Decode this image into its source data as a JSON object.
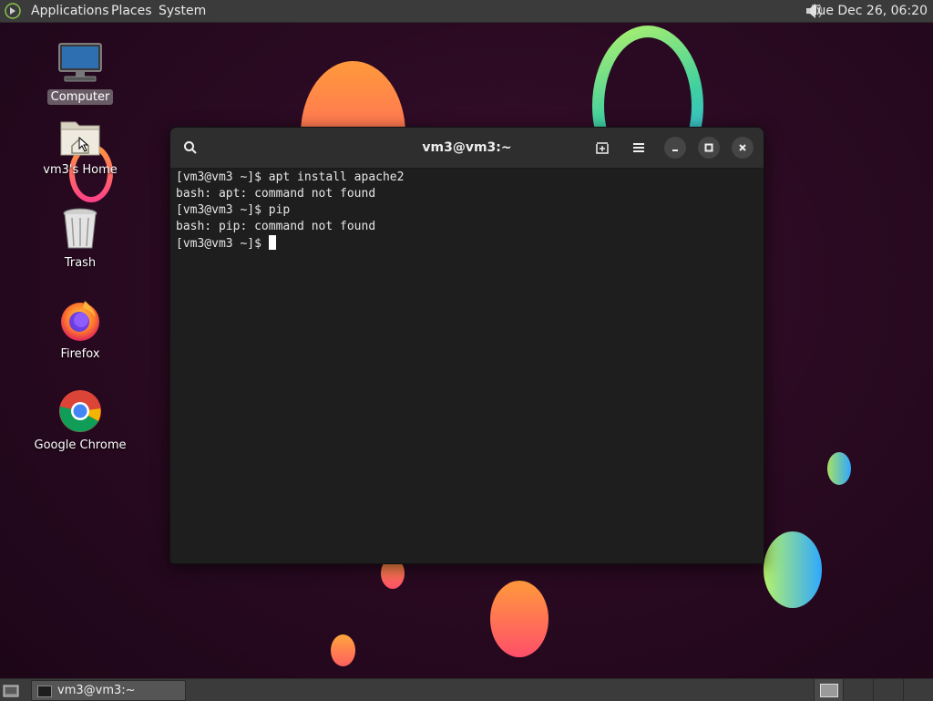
{
  "top_panel": {
    "menus": {
      "applications": "Applications",
      "places": "Places",
      "system": "System"
    },
    "clock": "Tue Dec 26, 06:20"
  },
  "desktop": {
    "icons": [
      {
        "label": "Computer",
        "icon": "computer-icon",
        "selected": true
      },
      {
        "label": "vm3's Home",
        "icon": "home-folder-icon"
      },
      {
        "label": "Trash",
        "icon": "trash-icon"
      },
      {
        "label": "Firefox",
        "icon": "firefox-icon"
      },
      {
        "label": "Google Chrome",
        "icon": "chrome-icon"
      }
    ]
  },
  "terminal": {
    "title": "vm3@vm3:~",
    "lines": [
      "[vm3@vm3 ~]$ apt install apache2",
      "bash: apt: command not found",
      "[vm3@vm3 ~]$ pip",
      "bash: pip: command not found",
      "[vm3@vm3 ~]$ "
    ]
  },
  "taskbar": {
    "window_button": "vm3@vm3:~"
  },
  "colors": {
    "panel": "#3b3b3b",
    "terminal_bg": "#1e1e1e",
    "terminal_header": "#2e2e2e",
    "desktop_bg": "#2a0a22"
  }
}
